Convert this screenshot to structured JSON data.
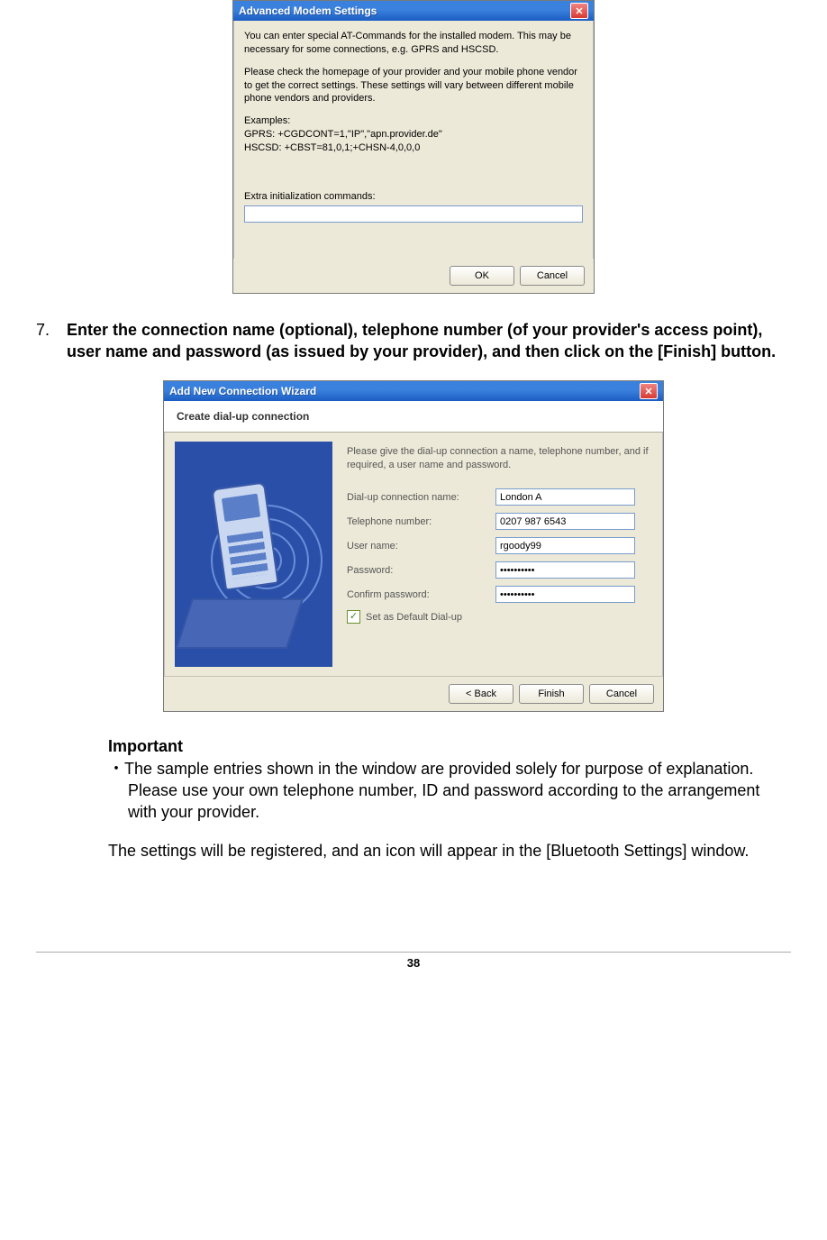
{
  "dialog1": {
    "title": "Advanced Modem Settings",
    "para1": "You can enter special AT-Commands for the installed modem. This may be necessary for some connections, e.g. GPRS and HSCSD.",
    "para2": "Please check the homepage of your provider and your mobile phone vendor to get the correct settings. These settings will vary between different mobile phone vendors and providers.",
    "examples_heading": "Examples:",
    "example_gprs": "GPRS: +CGDCONT=1,\"IP\",\"apn.provider.de\"",
    "example_hscsd": "HSCSD: +CBST=81,0,1;+CHSN-4,0,0,0",
    "extra_label": "Extra initialization commands:",
    "extra_value": "",
    "ok": "OK",
    "cancel": "Cancel"
  },
  "step": {
    "number": "7.",
    "text": "Enter the connection name (optional), telephone number (of your provider's access point), user name and password (as issued by your provider), and then click on the [Finish] button."
  },
  "dialog2": {
    "title": "Add New Connection Wizard",
    "header": "Create dial-up connection",
    "intro": "Please give the dial-up connection a name, telephone number, and if required, a user name and password.",
    "fields": {
      "conn_label": "Dial-up connection name:",
      "conn_value": "London A",
      "tel_label": "Telephone number:",
      "tel_value": "0207 987 6543",
      "user_label": "User name:",
      "user_value": "rgoody99",
      "pass_label": "Password:",
      "pass_value": "••••••••••",
      "confirm_label": "Confirm password:",
      "confirm_value": "••••••••••"
    },
    "checkbox_label": "Set as Default Dial-up",
    "checkbox_mark": "✓",
    "back": "< Back",
    "finish": "Finish",
    "cancel": "Cancel"
  },
  "important": {
    "heading": "Important",
    "bullet_mark": "・",
    "text": "The sample entries shown in the window are provided solely for purpose of explanation. Please use your own telephone number, ID and password according to the arrangement with your provider."
  },
  "result_text": "The settings will be registered, and an icon will appear in the [Bluetooth Settings] window.",
  "page_number": "38"
}
